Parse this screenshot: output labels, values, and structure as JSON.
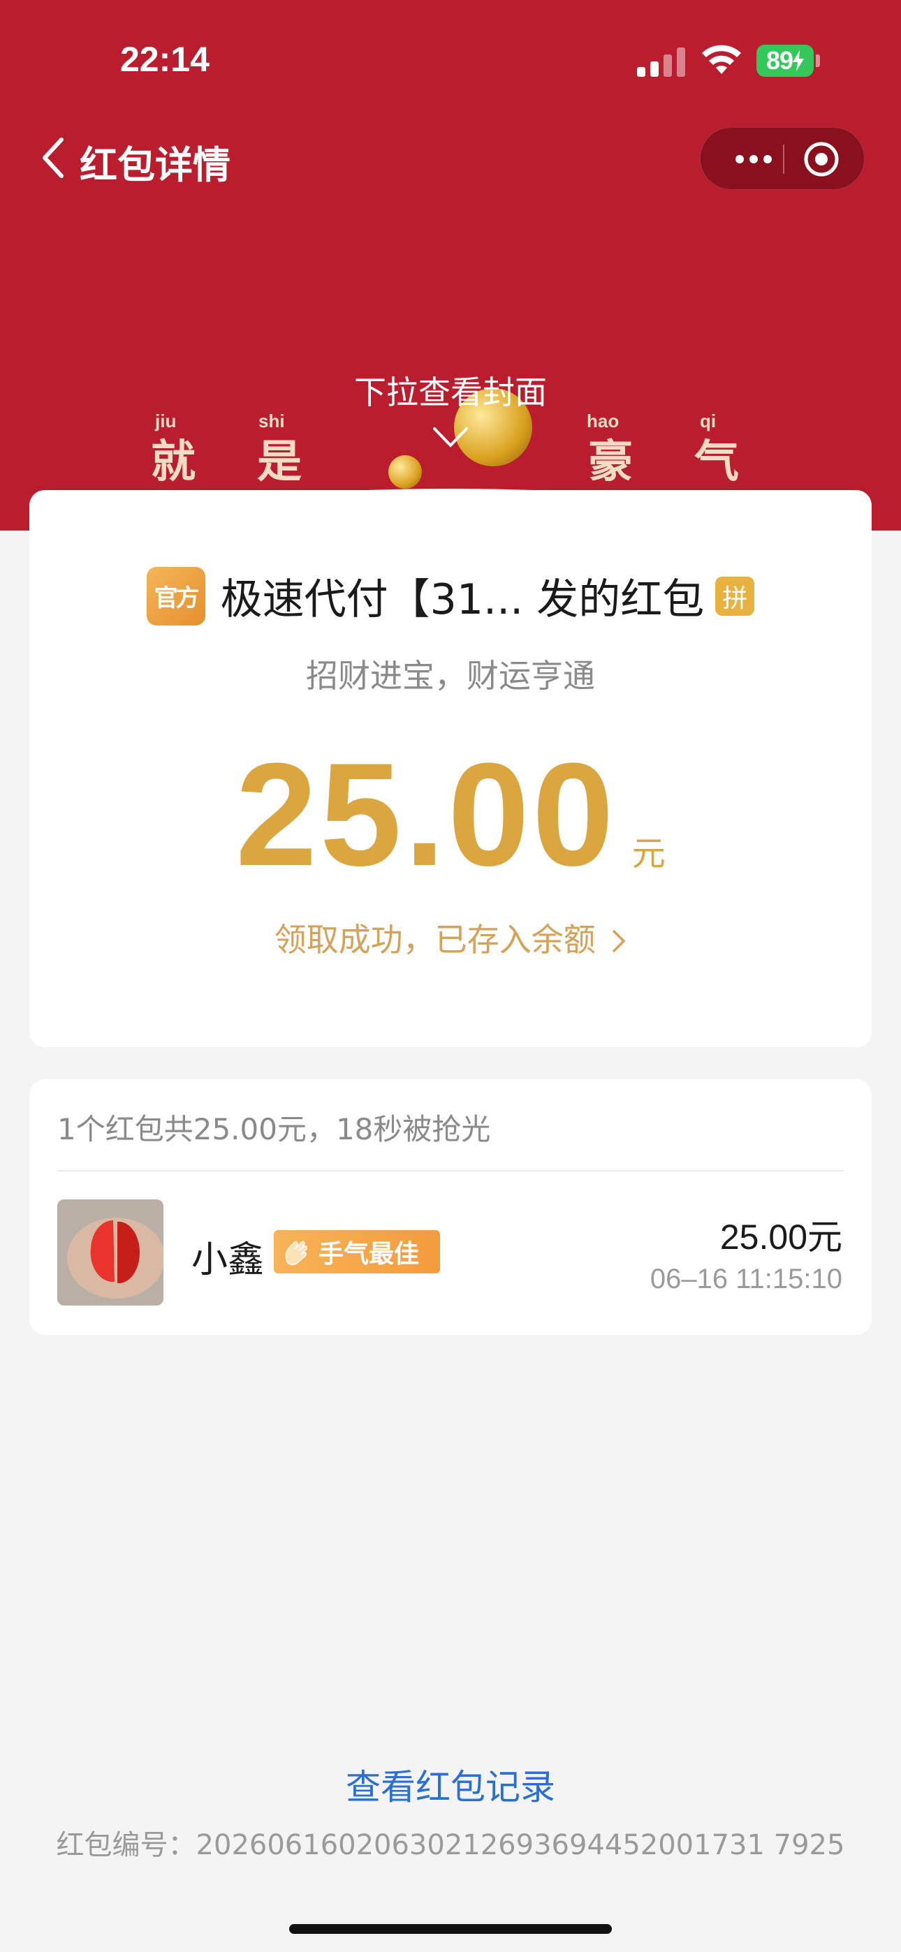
{
  "status_bar": {
    "time": "22:14",
    "battery": "89"
  },
  "nav": {
    "title": "红包详情"
  },
  "cover": {
    "pull_hint": "下拉查看封面",
    "blessing": [
      {
        "char": "就",
        "pinyin": "jiu"
      },
      {
        "char": "是",
        "pinyin": "shi"
      },
      {
        "char": "豪",
        "pinyin": "hao"
      },
      {
        "char": "气",
        "pinyin": "qi"
      }
    ]
  },
  "packet": {
    "official_badge": "官方",
    "sender": "极速代付【31... 发的红包",
    "pin_tag": "拼",
    "greeting": "招财进宝，财运亨通",
    "amount": "25.00",
    "unit": "元",
    "status": "领取成功，已存入余额"
  },
  "list": {
    "summary": "1个红包共25.00元，18秒被抢光",
    "items": [
      {
        "name": "小鑫",
        "badge": "手气最佳",
        "amount": "25.00元",
        "time": "06–16 11:15:10"
      }
    ]
  },
  "footer": {
    "records_link": "查看红包记录",
    "packet_id": "红包编号：20260616020630212693694452001731 7925"
  },
  "colors": {
    "header_red": "#ba1e2e",
    "gold": "#dba53f",
    "link_blue": "#2b6fd0"
  }
}
